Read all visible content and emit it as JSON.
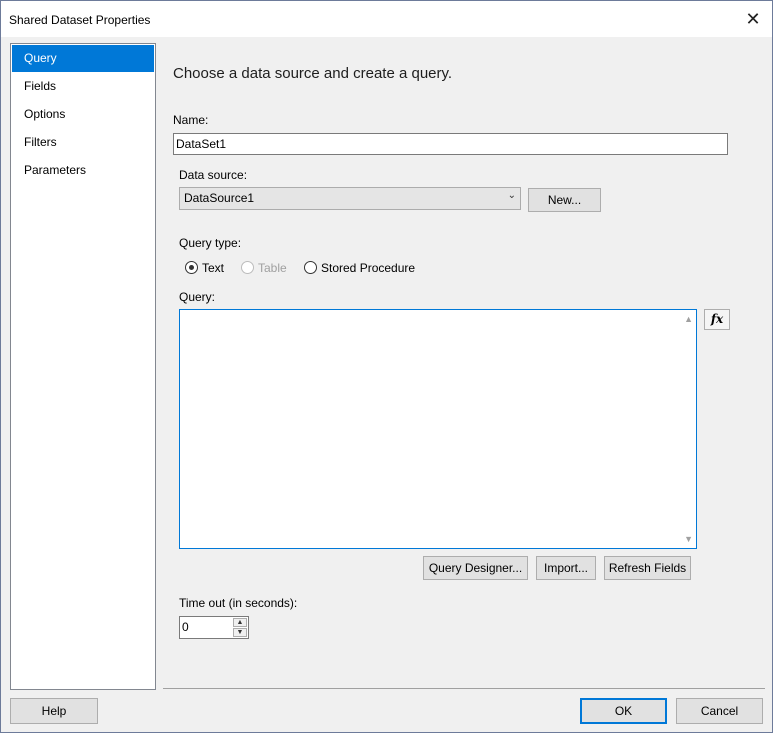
{
  "window": {
    "title": "Shared Dataset Properties",
    "close_glyph": "✕"
  },
  "nav": {
    "items": [
      {
        "label": "Query"
      },
      {
        "label": "Fields"
      },
      {
        "label": "Options"
      },
      {
        "label": "Filters"
      },
      {
        "label": "Parameters"
      }
    ],
    "selected": "Query"
  },
  "main": {
    "heading": "Choose a data source and create a query.",
    "name_label": "Name:",
    "name_value": "DataSet1",
    "datasource_label": "Data source:",
    "datasource_value": "DataSource1",
    "new_button": "New...",
    "querytype_label": "Query type:",
    "querytype_options": [
      {
        "label": "Text",
        "checked": true,
        "disabled": false
      },
      {
        "label": "Table",
        "checked": false,
        "disabled": true
      },
      {
        "label": "Stored Procedure",
        "checked": false,
        "disabled": false
      }
    ],
    "query_label": "Query:",
    "query_text": "",
    "fx_glyph": "fx",
    "query_designer_button": "Query Designer...",
    "import_button": "Import...",
    "refresh_fields_button": "Refresh Fields",
    "timeout_label": "Time out (in seconds):",
    "timeout_value": "0"
  },
  "footer": {
    "help": "Help",
    "ok": "OK",
    "cancel": "Cancel"
  },
  "colors": {
    "accent": "#0078d7",
    "panel": "#f0f0f0"
  }
}
